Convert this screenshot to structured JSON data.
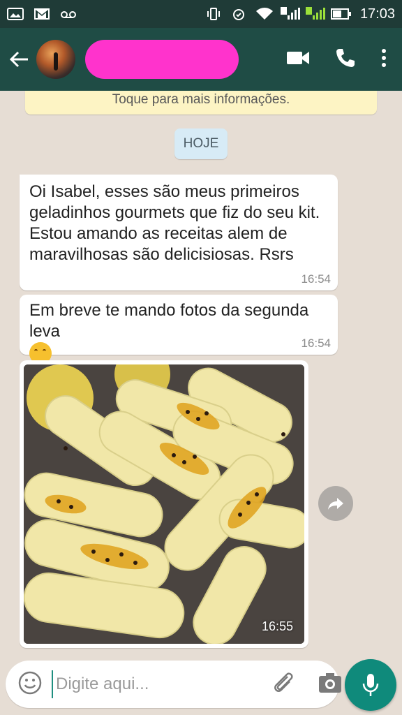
{
  "status_bar": {
    "time": "17:03",
    "sim1_label": "1",
    "sim2_label": "2"
  },
  "header": {
    "contact_name": "",
    "icons": [
      "back-arrow-icon",
      "video-call-icon",
      "phone-icon",
      "more-vert-icon"
    ]
  },
  "chat": {
    "info_banner": "Toque para mais informações.",
    "date_chip": "HOJE",
    "messages": [
      {
        "text": "Oi Isabel, esses são meus primeiros geladinhos gourmets que fiz do seu kit. Estou amando as receitas alem de maravilhosas são  delicisiosas. Rsrs",
        "time": "16:54"
      },
      {
        "text": "Em breve te mando fotos da segunda leva",
        "time": "16:54"
      },
      {
        "type": "image",
        "time": "16:55"
      }
    ]
  },
  "input": {
    "placeholder": "Digite aqui..."
  },
  "colors": {
    "status_bar": "#1f3b37",
    "app_bar": "#1f4c45",
    "chat_background": "#e6ddd4",
    "accent": "#0f8a7b",
    "banner": "#fdf4c4",
    "date_chip": "#d7ebf6"
  }
}
